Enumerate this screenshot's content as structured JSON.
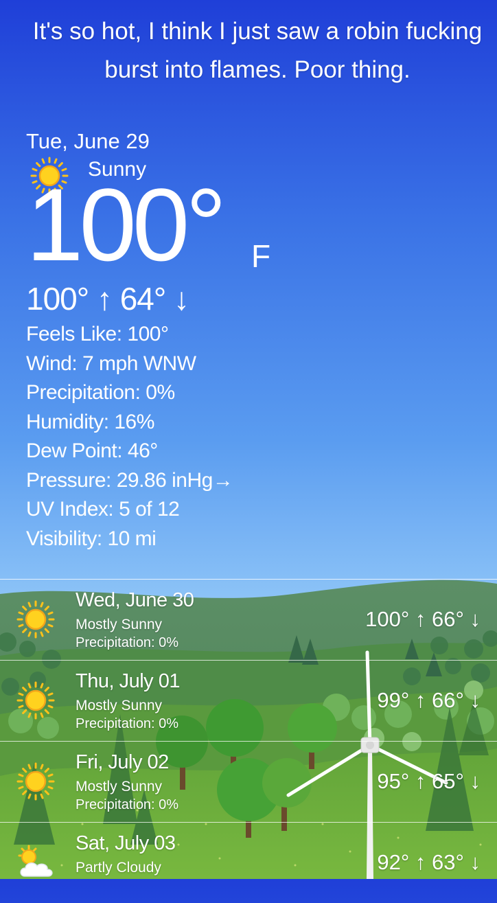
{
  "headline": "It's so hot, I think I just saw a robin fucking burst into flames. Poor thing.",
  "today": {
    "date": "Tue, June 29",
    "condition": "Sunny",
    "icon": "sun-icon",
    "temp": "100°",
    "unit": "F",
    "hi_lo": "100° ↑  64° ↓",
    "details": [
      "Feels Like:  100°",
      "Wind:  7 mph WNW",
      "Precipitation:   0%",
      "Humidity:  16%",
      "Dew Point:  46°",
      "Pressure:  29.86 inHg→",
      "UV Index:  5 of 12",
      "Visibility:  10 mi"
    ]
  },
  "forecast": [
    {
      "date": "Wed, June 30",
      "condition": "Mostly Sunny",
      "precip": "Precipitation:  0%",
      "hi_lo": "100° ↑  66° ↓",
      "icon": "sun-icon"
    },
    {
      "date": "Thu, July 01",
      "condition": "Mostly Sunny",
      "precip": "Precipitation:  0%",
      "hi_lo": "99° ↑  66° ↓",
      "icon": "sun-icon"
    },
    {
      "date": "Fri, July 02",
      "condition": "Mostly Sunny",
      "precip": "Precipitation:  0%",
      "hi_lo": "95° ↑  65° ↓",
      "icon": "sun-icon"
    },
    {
      "date": "Sat, July 03",
      "condition": "Partly Cloudy",
      "precip": "",
      "hi_lo": "92° ↑  63° ↓",
      "icon": "partly-cloudy-icon"
    }
  ],
  "colors": {
    "sky_top": "#1f3fd8",
    "sky_bottom": "#a9d4f9",
    "grass": "#6fae3a",
    "sun": "#ffd21f"
  }
}
